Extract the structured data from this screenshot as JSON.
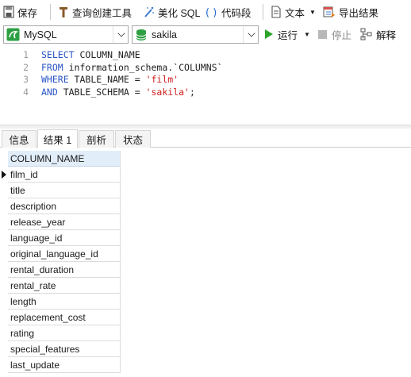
{
  "toolbar": {
    "save": "保存",
    "query_builder": "查询创建工具",
    "beautify_sql": "美化 SQL",
    "code_snippet": "代码段",
    "text": "文本",
    "export_results": "导出结果"
  },
  "connection_bar": {
    "connection_type": "MySQL",
    "database": "sakila",
    "run": "运行",
    "stop": "停止",
    "explain": "解释"
  },
  "editor": {
    "lines": [
      {
        "num": "1",
        "kw": "SELECT",
        "rest": " COLUMN_NAME",
        "str": "",
        "tail": ""
      },
      {
        "num": "2",
        "kw": "FROM",
        "rest": " information_schema.`COLUMNS`",
        "str": "",
        "tail": ""
      },
      {
        "num": "3",
        "kw": "WHERE",
        "rest": " TABLE_NAME = ",
        "str": "'film'",
        "tail": ""
      },
      {
        "num": "4",
        "kw": "AND",
        "rest": " TABLE_SCHEMA = ",
        "str": "'sakila'",
        "tail": ";"
      }
    ]
  },
  "result_tabs": [
    "信息",
    "结果 1",
    "剖析",
    "状态"
  ],
  "active_tab_index": 1,
  "result_grid": {
    "header": "COLUMN_NAME",
    "rows": [
      "film_id",
      "title",
      "description",
      "release_year",
      "language_id",
      "original_language_id",
      "rental_duration",
      "rental_rate",
      "length",
      "replacement_cost",
      "rating",
      "special_features",
      "last_update"
    ],
    "current_row_index": 0
  },
  "colors": {
    "keyword": "#2a55c5",
    "string": "#d01c1c",
    "grid_header_bg": "#e1edf9",
    "run_icon": "#2aa52a"
  }
}
